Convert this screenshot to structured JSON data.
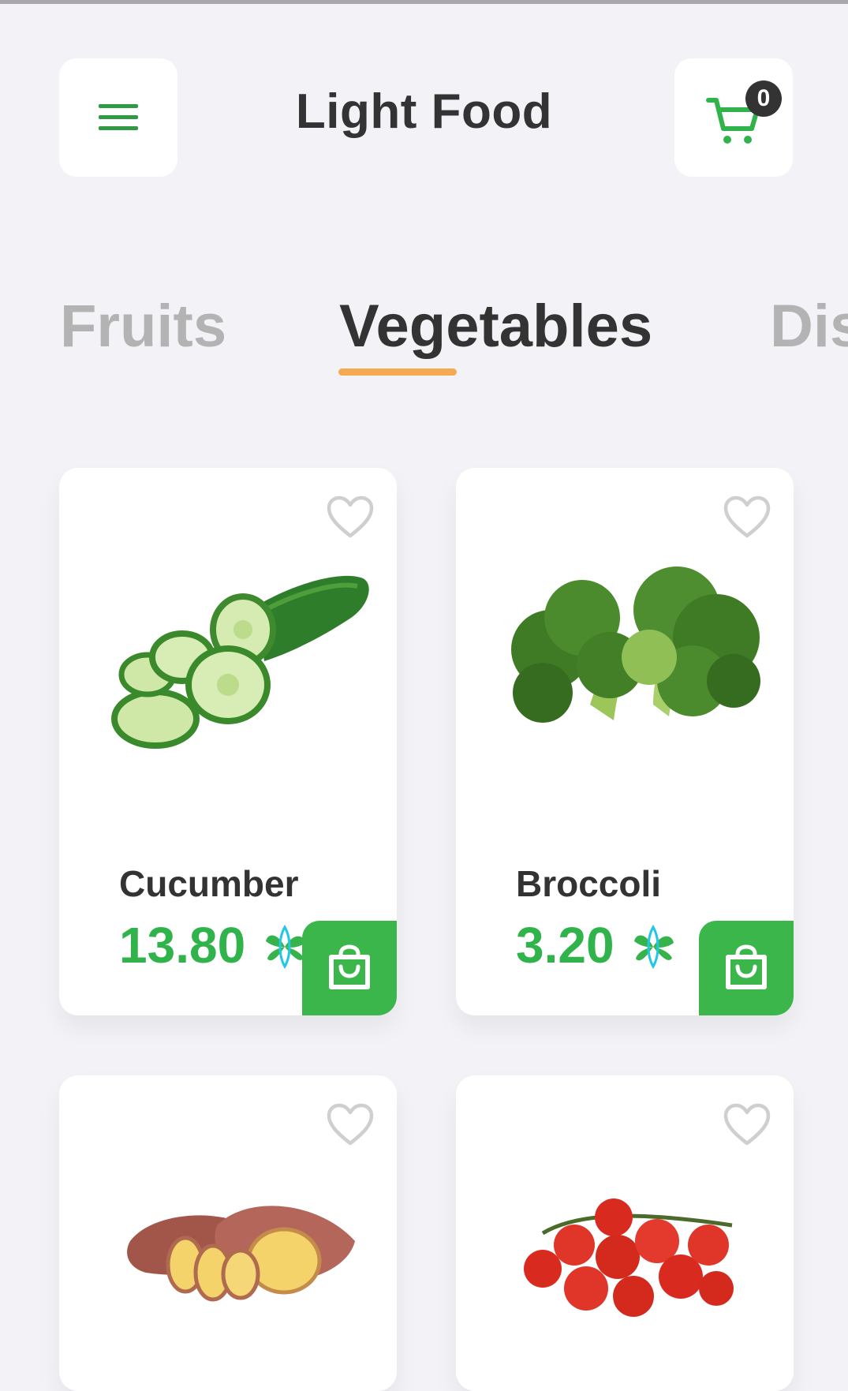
{
  "header": {
    "title": "Light Food",
    "cart_count": "0",
    "menu_icon": "menu-icon",
    "cart_icon": "cart-icon"
  },
  "tabs": [
    {
      "label": "Fruits",
      "active": false
    },
    {
      "label": "Vegetables",
      "active": true
    },
    {
      "label": "Dis",
      "active": false
    }
  ],
  "products": [
    {
      "name": "Cucumber",
      "price": "13.80",
      "image": "cucumber"
    },
    {
      "name": "Broccoli",
      "price": "3.20",
      "image": "broccoli"
    },
    {
      "name": "",
      "price": "",
      "image": "sweet-potato"
    },
    {
      "name": "",
      "price": "",
      "image": "cherry-tomatoes"
    }
  ],
  "colors": {
    "accent_green": "#3bb64a",
    "price_green": "#2fb34a",
    "tab_underline": "#f4a953",
    "background": "#f3f3f7",
    "text_dark": "#333333"
  }
}
